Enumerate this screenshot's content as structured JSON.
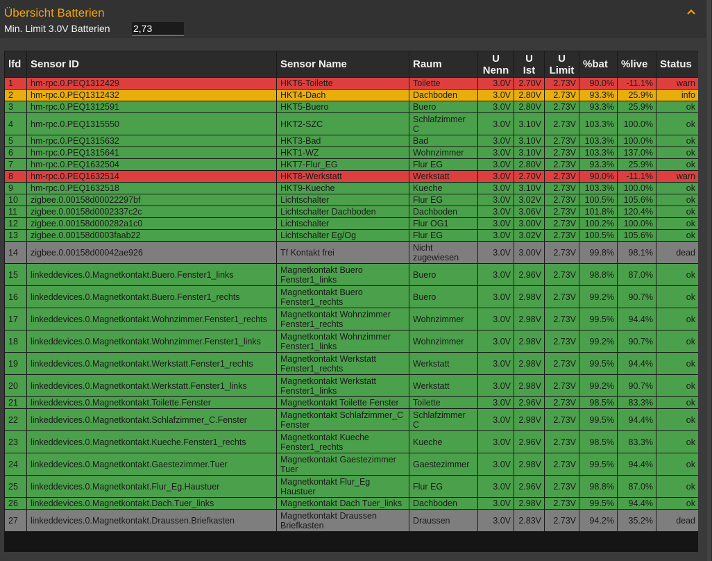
{
  "header": {
    "title": "Übersicht Batterien",
    "limit_label": "Min. Limit 3.0V Batterien",
    "limit_value": "2,73",
    "collapse_icon": "chevron-up-icon"
  },
  "colors": {
    "accent": "#f0a30a",
    "ok": "#4ba04b",
    "warn": "#dd3f3f",
    "info": "#e8ae0c",
    "dead": "#7e7e7e"
  },
  "columns": {
    "lfd": "lfd",
    "sensor_id": "Sensor ID",
    "sensor_name": "Sensor Name",
    "raum": "Raum",
    "u_nenn": [
      "U",
      "Nenn"
    ],
    "u_ist": [
      "U",
      "Ist"
    ],
    "u_limit": [
      "U",
      "Limit"
    ],
    "pbat": "%bat",
    "plive": "%live",
    "status": "Status"
  },
  "rows": [
    {
      "lfd": "1",
      "id": "hm-rpc.0.PEQ1312429",
      "name": "HKT6-Toilette",
      "raum": "Toilette",
      "nenn": "3.0V",
      "ist": "2.70V",
      "limit": "2.73V",
      "bat": "90.0%",
      "live": "-11.1%",
      "status": "warn"
    },
    {
      "lfd": "2",
      "id": "hm-rpc.0.PEQ1312432",
      "name": "HKT4-Dach",
      "raum": "Dachboden",
      "nenn": "3.0V",
      "ist": "2.80V",
      "limit": "2.73V",
      "bat": "93.3%",
      "live": "25.9%",
      "status": "info"
    },
    {
      "lfd": "3",
      "id": "hm-rpc.0.PEQ1312591",
      "name": "HKT5-Buero",
      "raum": "Buero",
      "nenn": "3.0V",
      "ist": "2.80V",
      "limit": "2.73V",
      "bat": "93.3%",
      "live": "25.9%",
      "status": "ok"
    },
    {
      "lfd": "4",
      "id": "hm-rpc.0.PEQ1315550",
      "name": "HKT2-SZC",
      "raum": "Schlafzimmer C",
      "nenn": "3.0V",
      "ist": "3.10V",
      "limit": "2.73V",
      "bat": "103.3%",
      "live": "100.0%",
      "status": "ok"
    },
    {
      "lfd": "5",
      "id": "hm-rpc.0.PEQ1315632",
      "name": "HKT3-Bad",
      "raum": "Bad",
      "nenn": "3.0V",
      "ist": "3.10V",
      "limit": "2.73V",
      "bat": "103.3%",
      "live": "100.0%",
      "status": "ok"
    },
    {
      "lfd": "6",
      "id": "hm-rpc.0.PEQ1315641",
      "name": "HKT1-WZ",
      "raum": "Wohnzimmer",
      "nenn": "3.0V",
      "ist": "3.10V",
      "limit": "2.73V",
      "bat": "103.3%",
      "live": "137.0%",
      "status": "ok"
    },
    {
      "lfd": "7",
      "id": "hm-rpc.0.PEQ1632504",
      "name": "HKT7-Flur_EG",
      "raum": "Flur EG",
      "nenn": "3.0V",
      "ist": "2.80V",
      "limit": "2.73V",
      "bat": "93.3%",
      "live": "25.9%",
      "status": "ok"
    },
    {
      "lfd": "8",
      "id": "hm-rpc.0.PEQ1632514",
      "name": "HKT8-Werkstatt",
      "raum": "Werkstatt",
      "nenn": "3.0V",
      "ist": "2.70V",
      "limit": "2.73V",
      "bat": "90.0%",
      "live": "-11.1%",
      "status": "warn"
    },
    {
      "lfd": "9",
      "id": "hm-rpc.0.PEQ1632518",
      "name": "HKT9-Kueche",
      "raum": "Kueche",
      "nenn": "3.0V",
      "ist": "3.10V",
      "limit": "2.73V",
      "bat": "103.3%",
      "live": "100.0%",
      "status": "ok"
    },
    {
      "lfd": "10",
      "id": "zigbee.0.00158d00022297bf",
      "name": "Lichtschalter",
      "raum": "Flur EG",
      "nenn": "3.0V",
      "ist": "3.02V",
      "limit": "2.73V",
      "bat": "100.5%",
      "live": "105.6%",
      "status": "ok"
    },
    {
      "lfd": "11",
      "id": "zigbee.0.00158d0002337c2c",
      "name": "Lichtschalter Dachboden",
      "raum": "Dachboden",
      "nenn": "3.0V",
      "ist": "3.06V",
      "limit": "2.73V",
      "bat": "101.8%",
      "live": "120.4%",
      "status": "ok"
    },
    {
      "lfd": "12",
      "id": "zigbee.0.00158d000282a1c0",
      "name": "Lichtschalter",
      "raum": "Flur OG1",
      "nenn": "3.0V",
      "ist": "3.00V",
      "limit": "2.73V",
      "bat": "100.2%",
      "live": "100.0%",
      "status": "ok"
    },
    {
      "lfd": "13",
      "id": "zigbee.0.00158d0003faab22",
      "name": "Lichtschalter Eg/Og",
      "raum": "Flur EG",
      "nenn": "3.0V",
      "ist": "3.02V",
      "limit": "2.73V",
      "bat": "100.5%",
      "live": "105.6%",
      "status": "ok"
    },
    {
      "lfd": "14",
      "id": "zigbee.0.00158d00042ae926",
      "name": "Tf Kontakt frei",
      "raum": "Nicht zugewiesen",
      "nenn": "3.0V",
      "ist": "3.00V",
      "limit": "2.73V",
      "bat": "99.8%",
      "live": "98.1%",
      "status": "dead"
    },
    {
      "lfd": "15",
      "id": "linkeddevices.0.Magnetkontakt.Buero.Fenster1_links",
      "name": "Magnetkontakt Buero Fenster1_links",
      "raum": "Buero",
      "nenn": "3.0V",
      "ist": "2.96V",
      "limit": "2.73V",
      "bat": "98.8%",
      "live": "87.0%",
      "status": "ok"
    },
    {
      "lfd": "16",
      "id": "linkeddevices.0.Magnetkontakt.Buero.Fenster1_rechts",
      "name": "Magnetkontakt Buero Fenster1_rechts",
      "raum": "Buero",
      "nenn": "3.0V",
      "ist": "2.98V",
      "limit": "2.73V",
      "bat": "99.2%",
      "live": "90.7%",
      "status": "ok"
    },
    {
      "lfd": "17",
      "id": "linkeddevices.0.Magnetkontakt.Wohnzimmer.Fenster1_rechts",
      "name": "Magnetkontakt Wohnzimmer Fenster1_rechts",
      "raum": "Wohnzimmer",
      "nenn": "3.0V",
      "ist": "2.98V",
      "limit": "2.73V",
      "bat": "99.5%",
      "live": "94.4%",
      "status": "ok"
    },
    {
      "lfd": "18",
      "id": "linkeddevices.0.Magnetkontakt.Wohnzimmer.Fenster1_links",
      "name": "Magnetkontakt Wohnzimmer Fenster1_links",
      "raum": "Wohnzimmer",
      "nenn": "3.0V",
      "ist": "2.98V",
      "limit": "2.73V",
      "bat": "99.2%",
      "live": "90.7%",
      "status": "ok"
    },
    {
      "lfd": "19",
      "id": "linkeddevices.0.Magnetkontakt.Werkstatt.Fenster1_rechts",
      "name": "Magnetkontakt Werkstatt Fenster1_rechts",
      "raum": "Werkstatt",
      "nenn": "3.0V",
      "ist": "2.98V",
      "limit": "2.73V",
      "bat": "99.5%",
      "live": "94.4%",
      "status": "ok"
    },
    {
      "lfd": "20",
      "id": "linkeddevices.0.Magnetkontakt.Werkstatt.Fenster1_links",
      "name": "Magnetkontakt Werkstatt Fenster1_links",
      "raum": "Werkstatt",
      "nenn": "3.0V",
      "ist": "2.98V",
      "limit": "2.73V",
      "bat": "99.2%",
      "live": "90.7%",
      "status": "ok"
    },
    {
      "lfd": "21",
      "id": "linkeddevices.0.Magnetkontakt.Toilette.Fenster",
      "name": "Magnetkontakt Toilette Fenster",
      "raum": "Toilette",
      "nenn": "3.0V",
      "ist": "2.96V",
      "limit": "2.73V",
      "bat": "98.5%",
      "live": "83.3%",
      "status": "ok"
    },
    {
      "lfd": "22",
      "id": "linkeddevices.0.Magnetkontakt.Schlafzimmer_C.Fenster",
      "name": "Magnetkontakt Schlafzimmer_C Fenster",
      "raum": "Schlafzimmer C",
      "nenn": "3.0V",
      "ist": "2.98V",
      "limit": "2.73V",
      "bat": "99.5%",
      "live": "94.4%",
      "status": "ok"
    },
    {
      "lfd": "23",
      "id": "linkeddevices.0.Magnetkontakt.Kueche.Fenster1_rechts",
      "name": "Magnetkontakt Kueche Fenster1_rechts",
      "raum": "Kueche",
      "nenn": "3.0V",
      "ist": "2.96V",
      "limit": "2.73V",
      "bat": "98.5%",
      "live": "83.3%",
      "status": "ok"
    },
    {
      "lfd": "24",
      "id": "linkeddevices.0.Magnetkontakt.Gaestezimmer.Tuer",
      "name": "Magnetkontakt Gaestezimmer Tuer",
      "raum": "Gaestezimmer",
      "nenn": "3.0V",
      "ist": "2.98V",
      "limit": "2.73V",
      "bat": "99.5%",
      "live": "94.4%",
      "status": "ok"
    },
    {
      "lfd": "25",
      "id": "linkeddevices.0.Magnetkontakt.Flur_Eg.Haustuer",
      "name": "Magnetkontakt Flur_Eg Haustuer",
      "raum": "Flur EG",
      "nenn": "3.0V",
      "ist": "2.96V",
      "limit": "2.73V",
      "bat": "98.8%",
      "live": "87.0%",
      "status": "ok"
    },
    {
      "lfd": "26",
      "id": "linkeddevices.0.Magnetkontakt.Dach.Tuer_links",
      "name": "Magnetkontakt Dach Tuer_links",
      "raum": "Dachboden",
      "nenn": "3.0V",
      "ist": "2.98V",
      "limit": "2.73V",
      "bat": "99.5%",
      "live": "94.4%",
      "status": "ok"
    },
    {
      "lfd": "27",
      "id": "linkeddevices.0.Magnetkontakt.Draussen.Briefkasten",
      "name": "Magnetkontakt Draussen Briefkasten",
      "raum": "Draussen",
      "nenn": "3.0V",
      "ist": "2.83V",
      "limit": "2.73V",
      "bat": "94.2%",
      "live": "35.2%",
      "status": "dead"
    }
  ]
}
